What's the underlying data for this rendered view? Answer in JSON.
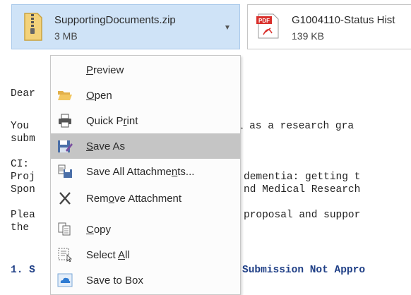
{
  "attachments": [
    {
      "name": "SupportingDocuments.zip",
      "size": "3 MB",
      "icon": "zip-file-icon"
    },
    {
      "name": "G1004110-Status Hist",
      "size": "139 KB",
      "icon": "pdf-file-icon",
      "badge": "PDF"
    }
  ],
  "email": {
    "lines": [
      "Dear",
      "You",
      "subm",
      "CI:",
      "Proj",
      "Spon",
      "Plea",
      "the",
      "1. S"
    ],
    "fragments": [
      "il as a research gra",
      "dementia: getting t",
      "nd Medical Research",
      "proposal and suppor",
      "Submission Not Appro"
    ]
  },
  "context_menu": {
    "items": [
      {
        "pre": "",
        "ul": "P",
        "post": "review",
        "icon": ""
      },
      {
        "pre": "",
        "ul": "O",
        "post": "pen",
        "icon": "folder-open-icon"
      },
      {
        "pre": "Quick P",
        "ul": "r",
        "post": "int",
        "icon": "printer-icon"
      },
      {
        "pre": "",
        "ul": "S",
        "post": "ave As",
        "icon": "save-as-icon",
        "highlighted": true
      },
      {
        "pre": "Save All Attachme",
        "ul": "n",
        "post": "ts...",
        "icon": "save-all-icon"
      },
      {
        "pre": "Rem",
        "ul": "o",
        "post": "ve Attachment",
        "icon": "remove-x-icon"
      },
      {
        "pre": "",
        "ul": "C",
        "post": "opy",
        "icon": "copy-icon"
      },
      {
        "pre": "Select ",
        "ul": "A",
        "post": "ll",
        "icon": "select-all-icon"
      },
      {
        "pre": "Save to Box",
        "ul": "",
        "post": "",
        "icon": "box-cloud-icon"
      }
    ]
  },
  "colors": {
    "selected_attachment_bg": "#cfe3f7",
    "menu_highlight": "#c5c5c5",
    "link_blue": "#1f3f86",
    "pdf_red": "#d9302c"
  }
}
